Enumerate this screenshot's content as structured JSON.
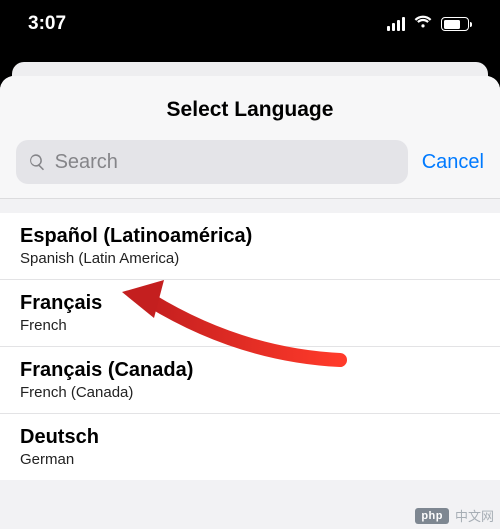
{
  "statusBar": {
    "time": "3:07"
  },
  "modal": {
    "title": "Select Language",
    "searchPlaceholder": "Search",
    "cancelLabel": "Cancel"
  },
  "languages": [
    {
      "native": "Español (Latinoamérica)",
      "english": "Spanish (Latin America)"
    },
    {
      "native": "Français",
      "english": "French"
    },
    {
      "native": "Français (Canada)",
      "english": "French (Canada)"
    },
    {
      "native": "Deutsch",
      "english": "German"
    }
  ],
  "watermark": {
    "badge": "php",
    "text": "中文网"
  }
}
